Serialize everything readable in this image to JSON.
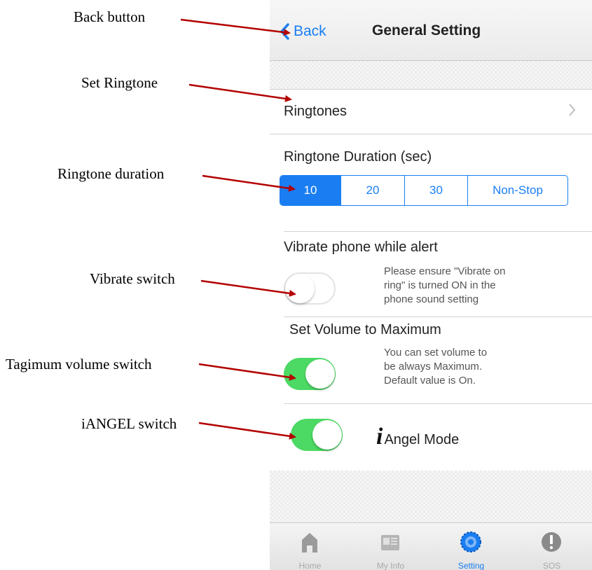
{
  "annotations": {
    "back": "Back button",
    "ringtone": "Set Ringtone",
    "duration": "Ringtone duration",
    "vibrate": "Vibrate switch",
    "volume": "Tagimum volume  switch",
    "iangel": "iANGEL switch"
  },
  "colors": {
    "accent": "#1a7ef2",
    "switch_on": "#4cd964",
    "arrow": "#b30000"
  },
  "navbar": {
    "back_label": "Back",
    "title": "General Setting"
  },
  "ringtones": {
    "label": "Ringtones"
  },
  "duration": {
    "label": "Ringtone Duration (sec)",
    "options": [
      "10",
      "20",
      "30",
      "Non-Stop"
    ],
    "selected": "10"
  },
  "vibrate": {
    "label": "Vibrate phone while alert",
    "note": [
      "Please ensure \"Vibrate on",
      "ring\" is turned ON in the",
      "phone sound setting"
    ],
    "on": false
  },
  "volume": {
    "label": "Set Volume to Maximum",
    "note": [
      "You can set volume to",
      "be always Maximum.",
      "Default value is On."
    ],
    "on": true
  },
  "angel": {
    "i": "i",
    "label": "Angel Mode",
    "on": true
  },
  "tabs": [
    {
      "label": "Home",
      "icon": "home-icon"
    },
    {
      "label": "My Info",
      "icon": "info-card-icon"
    },
    {
      "label": "Setting",
      "icon": "gear-icon",
      "active": true
    },
    {
      "label": "SOS",
      "icon": "alert-icon"
    }
  ]
}
